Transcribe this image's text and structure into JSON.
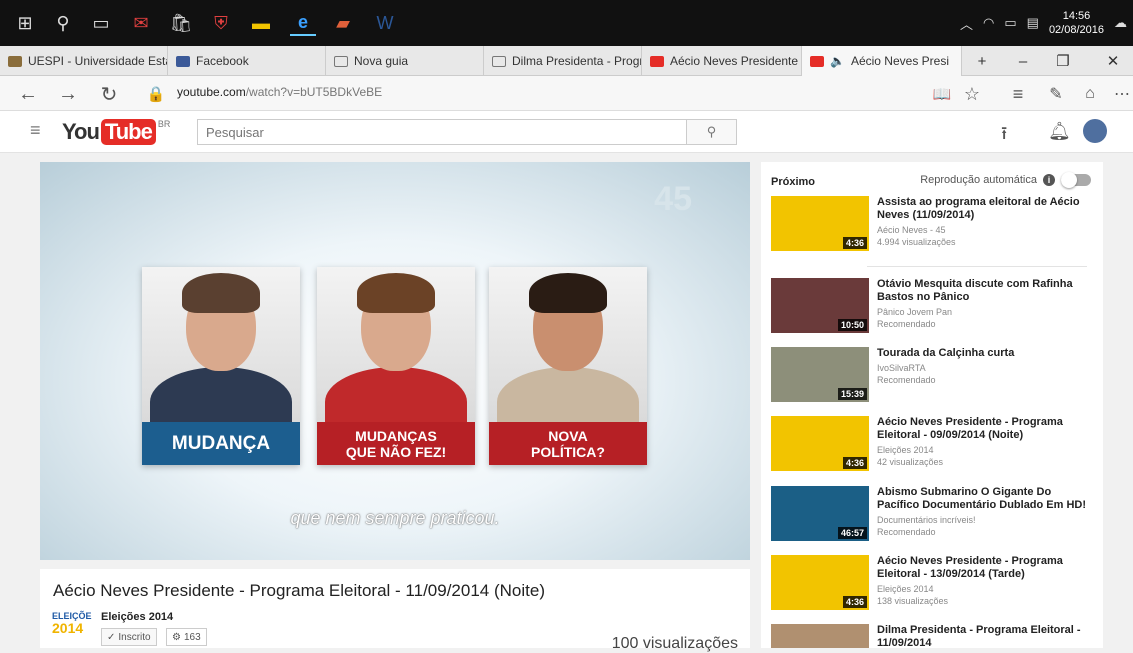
{
  "taskbar": {
    "icons": [
      "windows-icon",
      "search-icon",
      "task-view-icon",
      "mail-icon",
      "store-icon",
      "mcafee-icon",
      "file-explorer-icon",
      "edge-icon",
      "powerpoint-icon",
      "word-icon"
    ],
    "time": "14:56",
    "date": "02/08/2016"
  },
  "tabs": [
    {
      "label": "UESPI - Universidade Esta",
      "color": "#8a6d3b"
    },
    {
      "label": "Facebook",
      "color": "#3b5998"
    },
    {
      "label": "Nova guia",
      "color": "#777777"
    },
    {
      "label": "Dilma Presidenta - Prograr",
      "color": "#777777"
    },
    {
      "label": "Aécio Neves Presidente - I",
      "color": "#e52d27"
    },
    {
      "label": "Aécio Neves Presi",
      "color": "#e52d27"
    }
  ],
  "address": {
    "domain": "youtube.com",
    "path": "/watch?v=bUT5BDkVeBE"
  },
  "youtube": {
    "logo_you": "You",
    "logo_tube": "Tube",
    "logo_region": "BR",
    "search_placeholder": "Pesquisar"
  },
  "player": {
    "badge": "45",
    "cards": [
      {
        "caption": "MUDANÇA",
        "caption_color": "#1c5e8f",
        "suit_color": "#2d3a52",
        "hair_color": "#5a4030"
      },
      {
        "caption": "MUDANÇAS\nQUE NÃO FEZ!",
        "caption_color": "#b62025",
        "suit_color": "#c0292b",
        "hair_color": "#6b4226"
      },
      {
        "caption": "NOVA\nPOLÍTICA?",
        "caption_color": "#b62025",
        "suit_color": "#c9b7a0",
        "hair_color": "#2a1c14"
      }
    ],
    "subtitle": "que nem sempre praticou."
  },
  "video": {
    "title": "Aécio Neves Presidente - Programa Eleitoral - 11/09/2014 (Noite)",
    "channel_logo_top": "ELEIÇÕE",
    "channel_logo_year": "2014",
    "channel": "Eleições 2014",
    "subscribed": "Inscrito",
    "subscriber_count": "163",
    "views": "100 visualizações"
  },
  "sidebar": {
    "next_label": "Próximo",
    "autoplay_label": "Reprodução automática",
    "items": [
      {
        "title": "Assista ao programa eleitoral de Aécio Neves (11/09/2014)",
        "channel": "Aécio Neves - 45",
        "meta": "4.994 visualizações",
        "duration": "4:36",
        "thumb_color": "#f2c400"
      },
      {
        "title": "Otávio Mesquita discute com Rafinha Bastos no Pânico",
        "channel": "Pânico Jovem Pan",
        "meta": "Recomendado",
        "duration": "10:50",
        "thumb_color": "#6a3a3a"
      },
      {
        "title": "Tourada da Calçinha curta",
        "channel": "IvoSilvaRTA",
        "meta": "Recomendado",
        "duration": "15:39",
        "thumb_color": "#8d8f7a"
      },
      {
        "title": "Aécio Neves Presidente - Programa Eleitoral - 09/09/2014 (Noite)",
        "channel": "Eleições 2014",
        "meta": "42 visualizações",
        "duration": "4:36",
        "thumb_color": "#f2c400"
      },
      {
        "title": "Abismo Submarino O Gigante Do Pacífico Documentário Dublado Em HD!",
        "channel": "Documentários incríveis!",
        "meta": "Recomendado",
        "duration": "46:57",
        "thumb_color": "#1b5f86"
      },
      {
        "title": "Aécio Neves Presidente - Programa Eleitoral - 13/09/2014 (Tarde)",
        "channel": "Eleições 2014",
        "meta": "138 visualizações",
        "duration": "4:36",
        "thumb_color": "#f2c400"
      },
      {
        "title": "Dilma Presidenta - Programa Eleitoral - 11/09/2014",
        "channel": "",
        "meta": "",
        "duration": "",
        "thumb_color": "#b09070"
      }
    ]
  }
}
